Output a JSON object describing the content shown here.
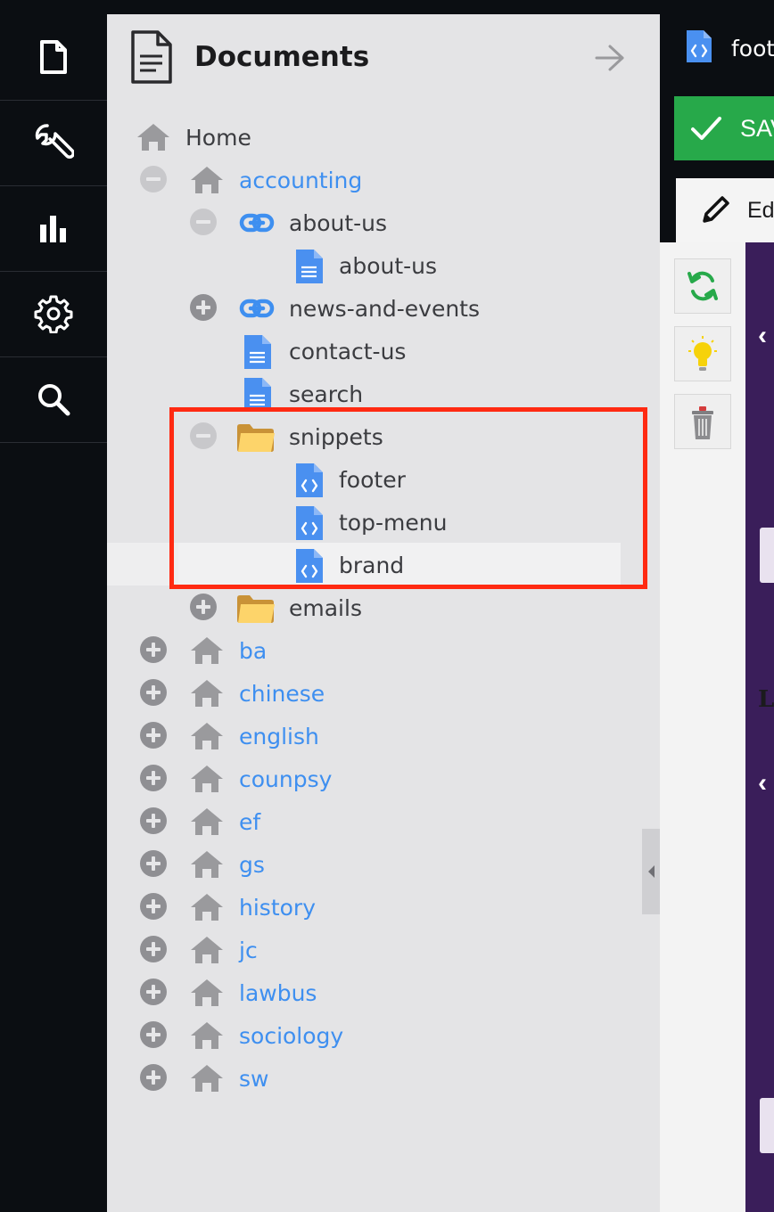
{
  "rail": {
    "items": [
      {
        "name": "content-section",
        "icon": "document-icon"
      },
      {
        "name": "developer-section",
        "icon": "wrench-icon"
      },
      {
        "name": "analytics-section",
        "icon": "bar-chart-icon"
      },
      {
        "name": "settings-section",
        "icon": "gear-icon"
      },
      {
        "name": "search-section",
        "icon": "search-icon"
      }
    ]
  },
  "panel": {
    "title": "Documents",
    "header_icon": "document-lines-icon",
    "collapse_icon": "arrow-right-icon"
  },
  "tree": [
    {
      "label": "Home",
      "toggle": "none",
      "icon": "home-icon",
      "color": "dark",
      "depth": 0
    },
    {
      "label": "accounting",
      "toggle": "minus",
      "icon": "home-icon",
      "color": "link",
      "depth": 1
    },
    {
      "label": "about-us",
      "toggle": "minus",
      "icon": "link-icon",
      "color": "dark",
      "depth": 2
    },
    {
      "label": "about-us",
      "toggle": "none",
      "icon": "page-icon",
      "color": "dark",
      "depth": 3
    },
    {
      "label": "news-and-events",
      "toggle": "plus",
      "icon": "link-icon",
      "color": "dark",
      "depth": 2
    },
    {
      "label": "contact-us",
      "toggle": "none",
      "icon": "page-icon",
      "color": "dark",
      "depth": 2
    },
    {
      "label": "search",
      "toggle": "none",
      "icon": "page-icon",
      "color": "dark",
      "depth": 2
    },
    {
      "label": "snippets",
      "toggle": "minus",
      "icon": "folder-icon",
      "color": "dark",
      "depth": 2
    },
    {
      "label": "footer",
      "toggle": "none",
      "icon": "snippet-icon",
      "color": "dark",
      "depth": 3
    },
    {
      "label": "top-menu",
      "toggle": "none",
      "icon": "snippet-icon",
      "color": "dark",
      "depth": 3
    },
    {
      "label": "brand",
      "toggle": "none",
      "icon": "snippet-icon",
      "color": "dark",
      "depth": 3,
      "selected": true
    },
    {
      "label": "emails",
      "toggle": "plus",
      "icon": "folder-icon",
      "color": "dark",
      "depth": 2
    },
    {
      "label": "ba",
      "toggle": "plus",
      "icon": "home-icon",
      "color": "link",
      "depth": 1
    },
    {
      "label": "chinese",
      "toggle": "plus",
      "icon": "home-icon",
      "color": "link",
      "depth": 1
    },
    {
      "label": "english",
      "toggle": "plus",
      "icon": "home-icon",
      "color": "link",
      "depth": 1
    },
    {
      "label": "counpsy",
      "toggle": "plus",
      "icon": "home-icon",
      "color": "link",
      "depth": 1
    },
    {
      "label": "ef",
      "toggle": "plus",
      "icon": "home-icon",
      "color": "link",
      "depth": 1
    },
    {
      "label": "gs",
      "toggle": "plus",
      "icon": "home-icon",
      "color": "link",
      "depth": 1
    },
    {
      "label": "history",
      "toggle": "plus",
      "icon": "home-icon",
      "color": "link",
      "depth": 1
    },
    {
      "label": "jc",
      "toggle": "plus",
      "icon": "home-icon",
      "color": "link",
      "depth": 1
    },
    {
      "label": "lawbus",
      "toggle": "plus",
      "icon": "home-icon",
      "color": "link",
      "depth": 1
    },
    {
      "label": "sociology",
      "toggle": "plus",
      "icon": "home-icon",
      "color": "link",
      "depth": 1
    },
    {
      "label": "sw",
      "toggle": "plus",
      "icon": "home-icon",
      "color": "link",
      "depth": 1
    }
  ],
  "editor": {
    "tab_title": "foot",
    "tab_icon": "snippet-icon",
    "save_label": "SAV",
    "edit_tab_label": "Ed",
    "tools": [
      {
        "name": "refresh-button",
        "icon": "refresh-icon"
      },
      {
        "name": "hint-button",
        "icon": "lightbulb-icon"
      },
      {
        "name": "delete-button",
        "icon": "trash-icon"
      }
    ],
    "fragment_L": "L"
  },
  "colors": {
    "rail_bg": "#0b0e12",
    "panel_bg": "#e4e4e6",
    "link": "#3e8ff0",
    "text": "#3b3c40",
    "save_green": "#27a94a",
    "highlight": "#ff2a12",
    "folder": "#fdd46a",
    "page_blue": "#3e8ff0"
  }
}
